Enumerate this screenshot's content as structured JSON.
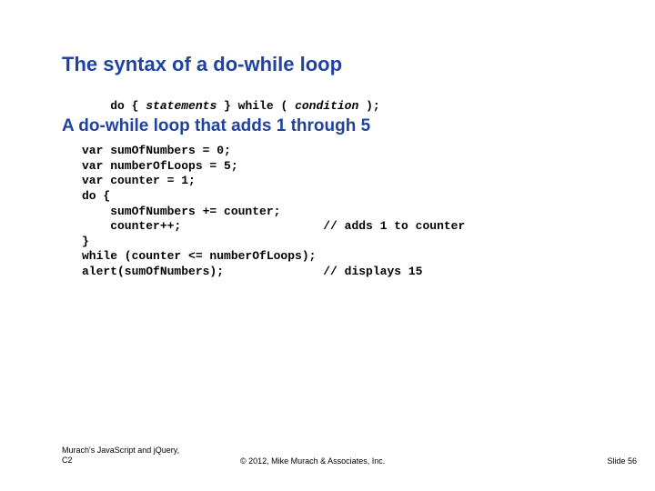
{
  "title": "The syntax of a do-while loop",
  "syntax": {
    "do": "do { ",
    "statements": "statements",
    "mid": " } while ( ",
    "condition": "condition",
    "end": " );"
  },
  "subheading": "A do-while loop that adds 1 through 5",
  "code": "var sumOfNumbers = 0;\nvar numberOfLoops = 5;\nvar counter = 1;\ndo {\n    sumOfNumbers += counter;\n    counter++;                    // adds 1 to counter\n}\nwhile (counter <= numberOfLoops);\nalert(sumOfNumbers);              // displays 15",
  "footer": {
    "left_line1": "Murach's JavaScript and jQuery,",
    "left_line2": "C2",
    "center": "© 2012, Mike Murach & Associates, Inc.",
    "right": "Slide 56"
  }
}
